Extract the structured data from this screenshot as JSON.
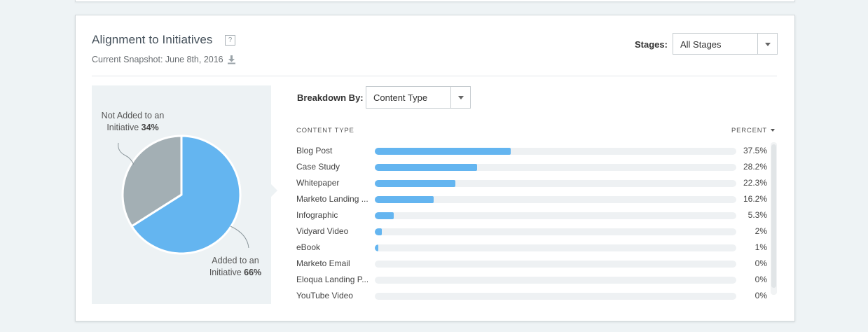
{
  "widget": {
    "title": "Alignment to Initiatives",
    "help_icon": "?",
    "snapshot": "Current Snapshot: June 8th, 2016"
  },
  "stages": {
    "label": "Stages:",
    "value": "All Stages"
  },
  "breakdown": {
    "label": "Breakdown By:",
    "value": "Content Type"
  },
  "pie": {
    "not_added": {
      "label_line1": "Not Added to an",
      "label_line2": "Initiative",
      "percent": "34%",
      "value": 34
    },
    "added": {
      "label_line1": "Added to an",
      "label_line2": "Initiative",
      "percent": "66%",
      "value": 66
    },
    "colors": {
      "added": "#64b5f0",
      "not_added": "#a3afb4"
    }
  },
  "table": {
    "col_type": "CONTENT TYPE",
    "col_percent": "PERCENT",
    "rows": [
      {
        "name": "Blog Post",
        "pct": "37.5%",
        "value": 37.5
      },
      {
        "name": "Case Study",
        "pct": "28.2%",
        "value": 28.2
      },
      {
        "name": "Whitepaper",
        "pct": "22.3%",
        "value": 22.3
      },
      {
        "name": "Marketo Landing ...",
        "pct": "16.2%",
        "value": 16.2
      },
      {
        "name": "Infographic",
        "pct": "5.3%",
        "value": 5.3
      },
      {
        "name": "Vidyard Video",
        "pct": "2%",
        "value": 2
      },
      {
        "name": "eBook",
        "pct": "1%",
        "value": 1
      },
      {
        "name": "Marketo Email",
        "pct": "0%",
        "value": 0
      },
      {
        "name": "Eloqua Landing P...",
        "pct": "0%",
        "value": 0
      },
      {
        "name": "YouTube Video",
        "pct": "0%",
        "value": 0
      }
    ]
  }
}
